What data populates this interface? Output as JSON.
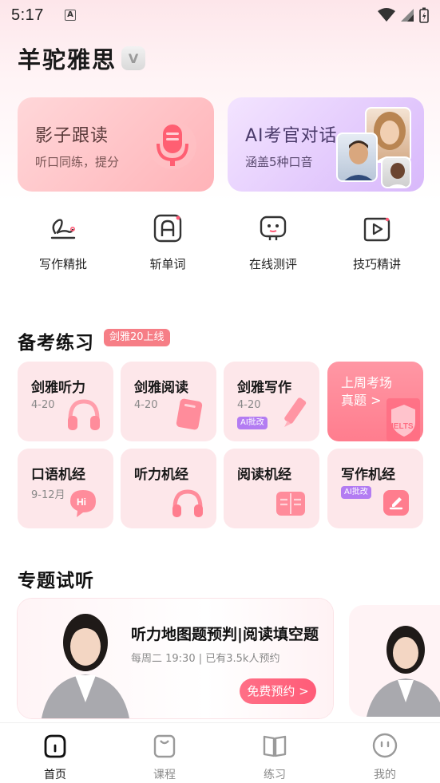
{
  "status": {
    "time": "5:17"
  },
  "brand": {
    "name": "羊驼雅思"
  },
  "cards": {
    "shadow": {
      "title": "影子跟读",
      "subtitle": "听口同练，提分"
    },
    "ai": {
      "title": "AI考官对话",
      "subtitle": "涵盖5种口音"
    }
  },
  "quick": [
    {
      "label": "写作精批",
      "icon": "pen-signature-icon"
    },
    {
      "label": "斩单词",
      "icon": "letter-a-icon"
    },
    {
      "label": "在线测评",
      "icon": "robot-icon"
    },
    {
      "label": "技巧精讲",
      "icon": "play-icon"
    }
  ],
  "practice": {
    "title": "备考练习",
    "badge": "剑雅20上线",
    "tiles": [
      {
        "title": "剑雅听力",
        "sub": "4-20"
      },
      {
        "title": "剑雅阅读",
        "sub": "4-20"
      },
      {
        "title": "剑雅写作",
        "sub": "4-20",
        "ai": "AI批改"
      },
      {
        "title": "上周考场",
        "title2": "真题 >",
        "book": "IELTS"
      },
      {
        "title": "口语机经",
        "sub": "9-12月",
        "bubble": "Hi"
      },
      {
        "title": "听力机经"
      },
      {
        "title": "阅读机经"
      },
      {
        "title": "写作机经",
        "ai": "AI批改"
      }
    ]
  },
  "topics": {
    "title": "专题试听",
    "course": {
      "title": "听力地图题预判|阅读填空题",
      "meta": "每周二 19:30 | 已有3.5k人预约",
      "button": "免费预约 >"
    }
  },
  "tabs": [
    {
      "label": "首页",
      "icon": "home-icon",
      "active": true
    },
    {
      "label": "课程",
      "icon": "bag-icon",
      "active": false
    },
    {
      "label": "练习",
      "icon": "book-icon",
      "active": false
    },
    {
      "label": "我的",
      "icon": "face-icon",
      "active": false
    }
  ],
  "colors": {
    "accent": "#ff5c78",
    "tile_bg": "#fde7ea",
    "ai_badge": "#b37cf2",
    "pill": "#f67e86"
  }
}
